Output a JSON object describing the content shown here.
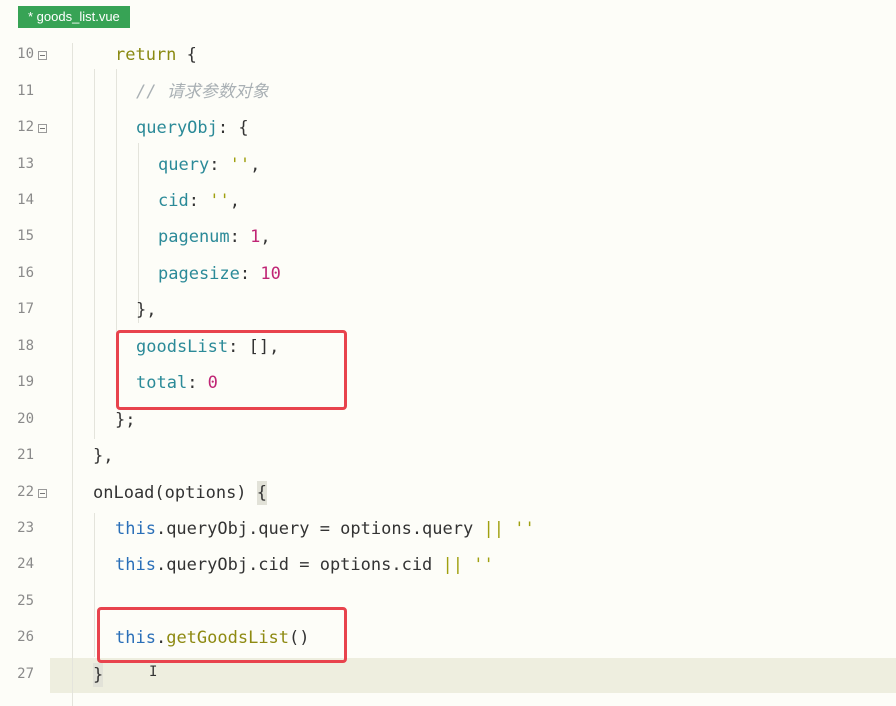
{
  "tab": {
    "title": "* goods_list.vue"
  },
  "line_numbers": [
    "10",
    "11",
    "12",
    "13",
    "14",
    "15",
    "16",
    "17",
    "18",
    "19",
    "20",
    "21",
    "22",
    "23",
    "24",
    "25",
    "26",
    "27"
  ],
  "code": {
    "l10": {
      "kw": "return",
      "rest": " {"
    },
    "l11": {
      "comment": "// 请求参数对象"
    },
    "l12": {
      "prop": "queryObj",
      "rest": ": {"
    },
    "l13": {
      "prop": "query",
      "sep": ": ",
      "val": "''",
      "end": ","
    },
    "l14": {
      "prop": "cid",
      "sep": ": ",
      "val": "''",
      "end": ","
    },
    "l15": {
      "prop": "pagenum",
      "sep": ": ",
      "val": "1",
      "end": ","
    },
    "l16": {
      "prop": "pagesize",
      "sep": ": ",
      "val": "10"
    },
    "l17": {
      "text": "},"
    },
    "l18": {
      "prop": "goodsList",
      "rest": ": [],"
    },
    "l19": {
      "prop": "total",
      "sep": ": ",
      "val": "0"
    },
    "l20": {
      "text": "};"
    },
    "l21": {
      "text": "},"
    },
    "l22": {
      "fn": "onLoad",
      "rest": "(options) ",
      "brace": "{"
    },
    "l23": {
      "this": "this",
      "a": ".queryObj.query = options.query ",
      "op": "||",
      "b": " ",
      "str": "''"
    },
    "l24": {
      "this": "this",
      "a": ".queryObj.cid = options.cid ",
      "op": "||",
      "b": " ",
      "str": "''"
    },
    "l26": {
      "this": "this",
      "dot": ".",
      "fn": "getGoodsList",
      "rest": "()"
    },
    "l27": {
      "text": "}"
    }
  },
  "colors": {
    "tab_bg": "#37a355",
    "highlight_box": "#e8434d",
    "current_line": "#eeeedf"
  }
}
